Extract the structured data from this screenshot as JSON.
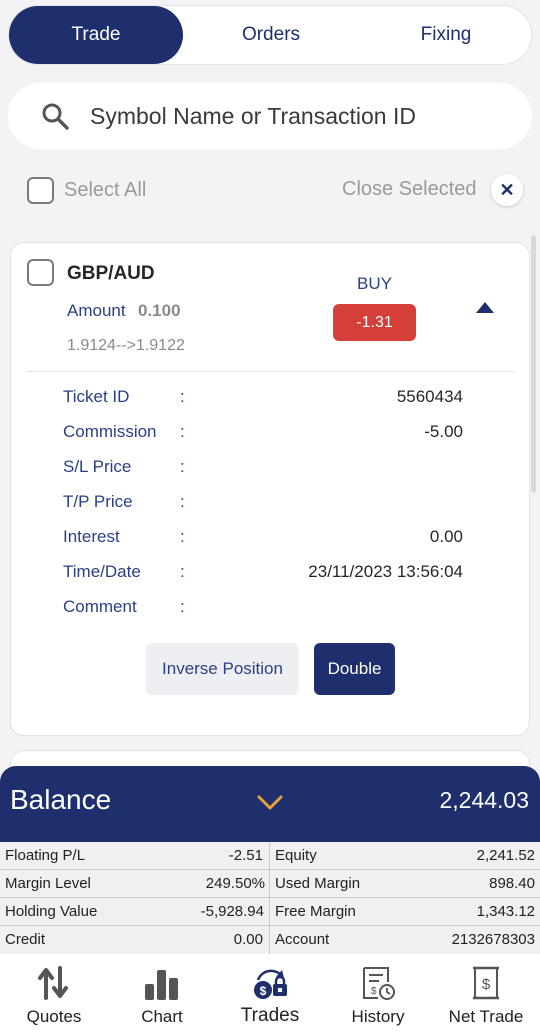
{
  "tabs": [
    {
      "label": "Trade",
      "active": true
    },
    {
      "label": "Orders",
      "active": false
    },
    {
      "label": "Fixing",
      "active": false
    }
  ],
  "search": {
    "placeholder": "Symbol Name or Transaction ID",
    "value": ""
  },
  "selection": {
    "select_all_label": "Select All",
    "close_selected_label": "Close Selected"
  },
  "position": {
    "symbol": "GBP/AUD",
    "amount_label": "Amount",
    "amount": "0.100",
    "price_range": "1.9124-->1.9122",
    "side": "BUY",
    "pl": "-1.31",
    "details": [
      {
        "label": "Ticket ID",
        "value": "5560434"
      },
      {
        "label": "Commission",
        "value": "-5.00"
      },
      {
        "label": "S/L Price",
        "value": ""
      },
      {
        "label": "T/P Price",
        "value": ""
      },
      {
        "label": "Interest",
        "value": "0.00"
      },
      {
        "label": "Time/Date",
        "value": "23/11/2023 13:56:04"
      },
      {
        "label": "Comment",
        "value": ""
      }
    ],
    "separator": ":",
    "inverse_label": "Inverse Position",
    "double_label": "Double"
  },
  "balance": {
    "title": "Balance",
    "value": "2,244.03",
    "stats": [
      {
        "label": "Floating P/L",
        "value": "-2.51",
        "label2": "Equity",
        "value2": "2,241.52"
      },
      {
        "label": "Margin Level",
        "value": "249.50%",
        "label2": "Used Margin",
        "value2": "898.40"
      },
      {
        "label": "Holding Value",
        "value": "-5,928.94",
        "label2": "Free Margin",
        "value2": "1,343.12"
      },
      {
        "label": "Credit",
        "value": "0.00",
        "label2": "Account",
        "value2": "2132678303"
      }
    ]
  },
  "nav": [
    {
      "label": "Quotes",
      "icon": "quotes-icon"
    },
    {
      "label": "Chart",
      "icon": "bar-chart-icon"
    },
    {
      "label": "Trades",
      "icon": "trades-icon",
      "active": true
    },
    {
      "label": "History",
      "icon": "history-icon"
    },
    {
      "label": "Net Trade",
      "icon": "net-trade-icon"
    }
  ],
  "colors": {
    "primary": "#1f2f6e",
    "loss": "#d43f3a",
    "accent": "#e5a13b"
  }
}
